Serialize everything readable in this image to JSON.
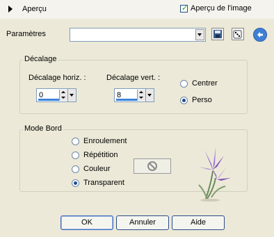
{
  "header": {
    "apercu_label": "Aperçu",
    "apercu_image_label": "Aperçu de l'image",
    "apercu_image_checked": true
  },
  "params": {
    "label": "Paramètres",
    "preset_value": "",
    "save_icon": "floppy-disk-icon",
    "random_icon": "dice-icon",
    "reset_icon": "reset-arrow-icon"
  },
  "decalage": {
    "title": "Décalage",
    "horiz_label": "Décalage horiz. :",
    "horiz_value": "0",
    "vert_label": "Décalage vert. :",
    "vert_value": "8",
    "centrer_label": "Centrer",
    "perso_label": "Perso",
    "selected": "Perso"
  },
  "mode_bord": {
    "title": "Mode Bord",
    "options": [
      "Enroulement",
      "Répétition",
      "Couleur",
      "Transparent"
    ],
    "selected": "Transparent",
    "color_icon": "no-symbol-icon"
  },
  "buttons": {
    "ok": "OK",
    "cancel": "Annuler",
    "help": "Aide"
  },
  "colors": {
    "dialog_bg": "#ece9d8",
    "accent": "#3b82dd"
  }
}
